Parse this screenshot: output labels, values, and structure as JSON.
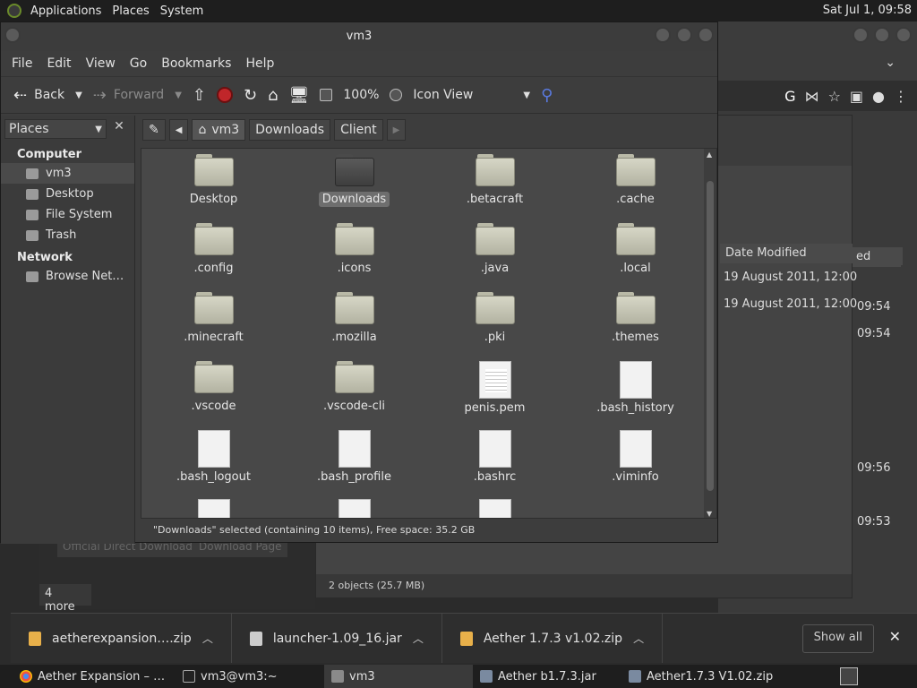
{
  "top_panel": {
    "menus": [
      "Applications",
      "Places",
      "System"
    ],
    "clock": "Sat Jul 1, 09:58"
  },
  "background": {
    "list_header": "Date Modified",
    "list_header2": "ed",
    "dates": [
      "19 August 2011, 12:00",
      "19 August 2011, 12:00"
    ],
    "times": [
      "09:54",
      "09:54",
      "09:56",
      "09:53"
    ],
    "status": "2 objects (25.7 MB)",
    "ghost_buttons": [
      "Official Direct Download",
      "Download Page"
    ],
    "more": "4 more"
  },
  "window": {
    "title": "vm3",
    "menus": [
      "File",
      "Edit",
      "View",
      "Go",
      "Bookmarks",
      "Help"
    ],
    "toolbar": {
      "back": "Back",
      "forward": "Forward",
      "zoom": "100%",
      "view_mode": "Icon View"
    },
    "sidebar": {
      "select": "Places",
      "sections": [
        {
          "heading": "Computer",
          "items": [
            "vm3",
            "Desktop",
            "File System",
            "Trash"
          ]
        },
        {
          "heading": "Network",
          "items": [
            "Browse Net…"
          ]
        }
      ]
    },
    "path": [
      "vm3",
      "Downloads",
      "Client"
    ],
    "items": [
      {
        "name": "Desktop",
        "kind": "folder-desktop"
      },
      {
        "name": "Downloads",
        "kind": "folder-dark",
        "selected": true
      },
      {
        "name": ".betacraft",
        "kind": "folder"
      },
      {
        "name": ".cache",
        "kind": "folder"
      },
      {
        "name": ".config",
        "kind": "folder"
      },
      {
        "name": ".icons",
        "kind": "folder"
      },
      {
        "name": ".java",
        "kind": "folder"
      },
      {
        "name": ".local",
        "kind": "folder"
      },
      {
        "name": ".minecraft",
        "kind": "folder"
      },
      {
        "name": ".mozilla",
        "kind": "folder"
      },
      {
        "name": ".pki",
        "kind": "folder"
      },
      {
        "name": ".themes",
        "kind": "folder"
      },
      {
        "name": ".vscode",
        "kind": "folder"
      },
      {
        "name": ".vscode-cli",
        "kind": "folder"
      },
      {
        "name": "penis.pem",
        "kind": "doc-lined"
      },
      {
        "name": ".bash_history",
        "kind": "doc"
      },
      {
        "name": ".bash_logout",
        "kind": "doc"
      },
      {
        "name": ".bash_profile",
        "kind": "doc"
      },
      {
        "name": ".bashrc",
        "kind": "doc"
      },
      {
        "name": ".viminfo",
        "kind": "doc"
      }
    ],
    "status": "\"Downloads\" selected (containing 10 items), Free space: 35.2 GB"
  },
  "download_bar": {
    "items": [
      "aetherexpansion….zip",
      "launcher-1.09_16.jar",
      "Aether 1.7.3 v1.02.zip"
    ],
    "show_all": "Show all"
  },
  "taskbar": {
    "tasks": [
      "Aether Expansion – …",
      "vm3@vm3:~",
      "vm3",
      "Aether b1.7.3.jar",
      "Aether1.7.3 V1.02.zip"
    ],
    "active_index": 2
  },
  "colors": {
    "selection": "#6e6e6e",
    "stop_red": "#c0262a",
    "download_icon": "#e8b04a"
  }
}
